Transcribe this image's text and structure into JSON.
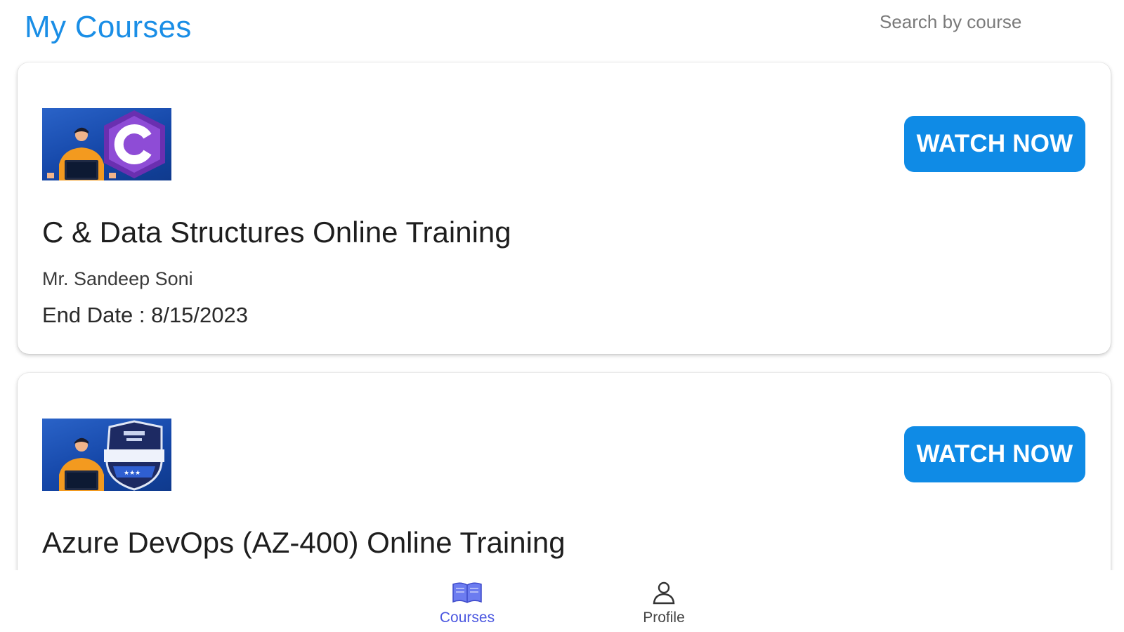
{
  "header": {
    "title": "My Courses",
    "search_placeholder": "Search by course"
  },
  "courses": [
    {
      "title": "C & Data Structures Online Training",
      "instructor": "Mr. Sandeep Soni",
      "end_date": "End Date : 8/15/2023",
      "button_label": "WATCH NOW",
      "thumbnail_icon": "c-language-logo-icon"
    },
    {
      "title": "Azure DevOps (AZ-400) Online Training",
      "button_label": "WATCH NOW",
      "thumbnail_icon": "azure-devops-badge-icon"
    }
  ],
  "bottom_nav": {
    "items": [
      {
        "label": "Courses",
        "icon": "book-icon",
        "active": true
      },
      {
        "label": "Profile",
        "icon": "user-icon",
        "active": false
      }
    ]
  },
  "colors": {
    "accent": "#1a8ee6",
    "button": "#0f8be6",
    "nav_active": "#4b57e0"
  }
}
